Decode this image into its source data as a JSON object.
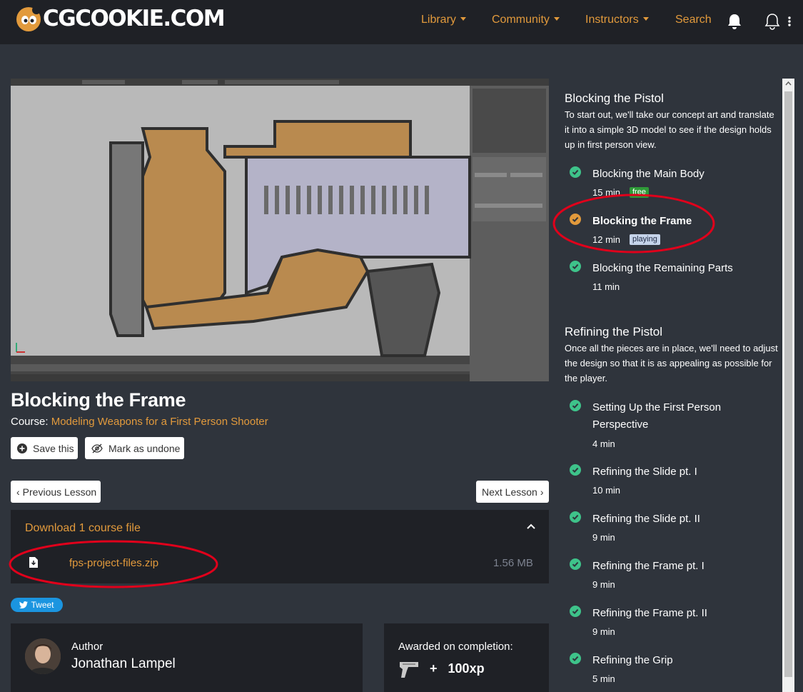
{
  "site": {
    "logo_text": "CGCOOKIE.COM"
  },
  "nav": {
    "library": "Library",
    "community": "Community",
    "instructors": "Instructors",
    "search": "Search"
  },
  "lesson": {
    "title": "Blocking the Frame",
    "course_label": "Course:",
    "course_name": "Modeling Weapons for a First Person Shooter",
    "save_label": "Save this",
    "mark_label": "Mark as undone",
    "prev_label": "Previous Lesson",
    "next_label": "Next Lesson"
  },
  "download": {
    "title": "Download 1 course file",
    "file_name": "fps-project-files.zip",
    "file_size": "1.56 MB"
  },
  "social": {
    "tweet_label": "Tweet"
  },
  "author": {
    "label": "Author",
    "name": "Jonathan Lampel"
  },
  "award": {
    "label": "Awarded on completion:",
    "plus": "+",
    "xp": "100xp"
  },
  "sidebar": {
    "sections": [
      {
        "title": "Blocking the Pistol",
        "description": "To start out, we'll take our concept art and translate it into a simple 3D model to see if the design holds up in first person view.",
        "lessons": [
          {
            "name": "Blocking the Main Body",
            "duration": "15 min",
            "badge": "free",
            "status": "done"
          },
          {
            "name": "Blocking the Frame",
            "duration": "12 min",
            "badge": "playing",
            "status": "current"
          },
          {
            "name": "Blocking the Remaining Parts",
            "duration": "11 min",
            "badge": "",
            "status": "done"
          }
        ]
      },
      {
        "title": "Refining the Pistol",
        "description": "Once all the pieces are in place, we'll need to adjust the design so that it is as appealing as possible for the player.",
        "lessons": [
          {
            "name": "Setting Up the First Person Perspective",
            "duration": "4 min",
            "status": "done"
          },
          {
            "name": "Refining the Slide pt. I",
            "duration": "10 min",
            "status": "done"
          },
          {
            "name": "Refining the Slide pt. II",
            "duration": "9 min",
            "status": "done"
          },
          {
            "name": "Refining the Frame pt. I",
            "duration": "9 min",
            "status": "done"
          },
          {
            "name": "Refining the Frame pt. II",
            "duration": "9 min",
            "status": "done"
          },
          {
            "name": "Refining the Grip",
            "duration": "5 min",
            "status": "done"
          }
        ]
      }
    ]
  },
  "colors": {
    "accent": "#e29a3c",
    "check_done": "#3ec38a",
    "check_current": "#e29a3c",
    "annotation": "#e0001b"
  }
}
